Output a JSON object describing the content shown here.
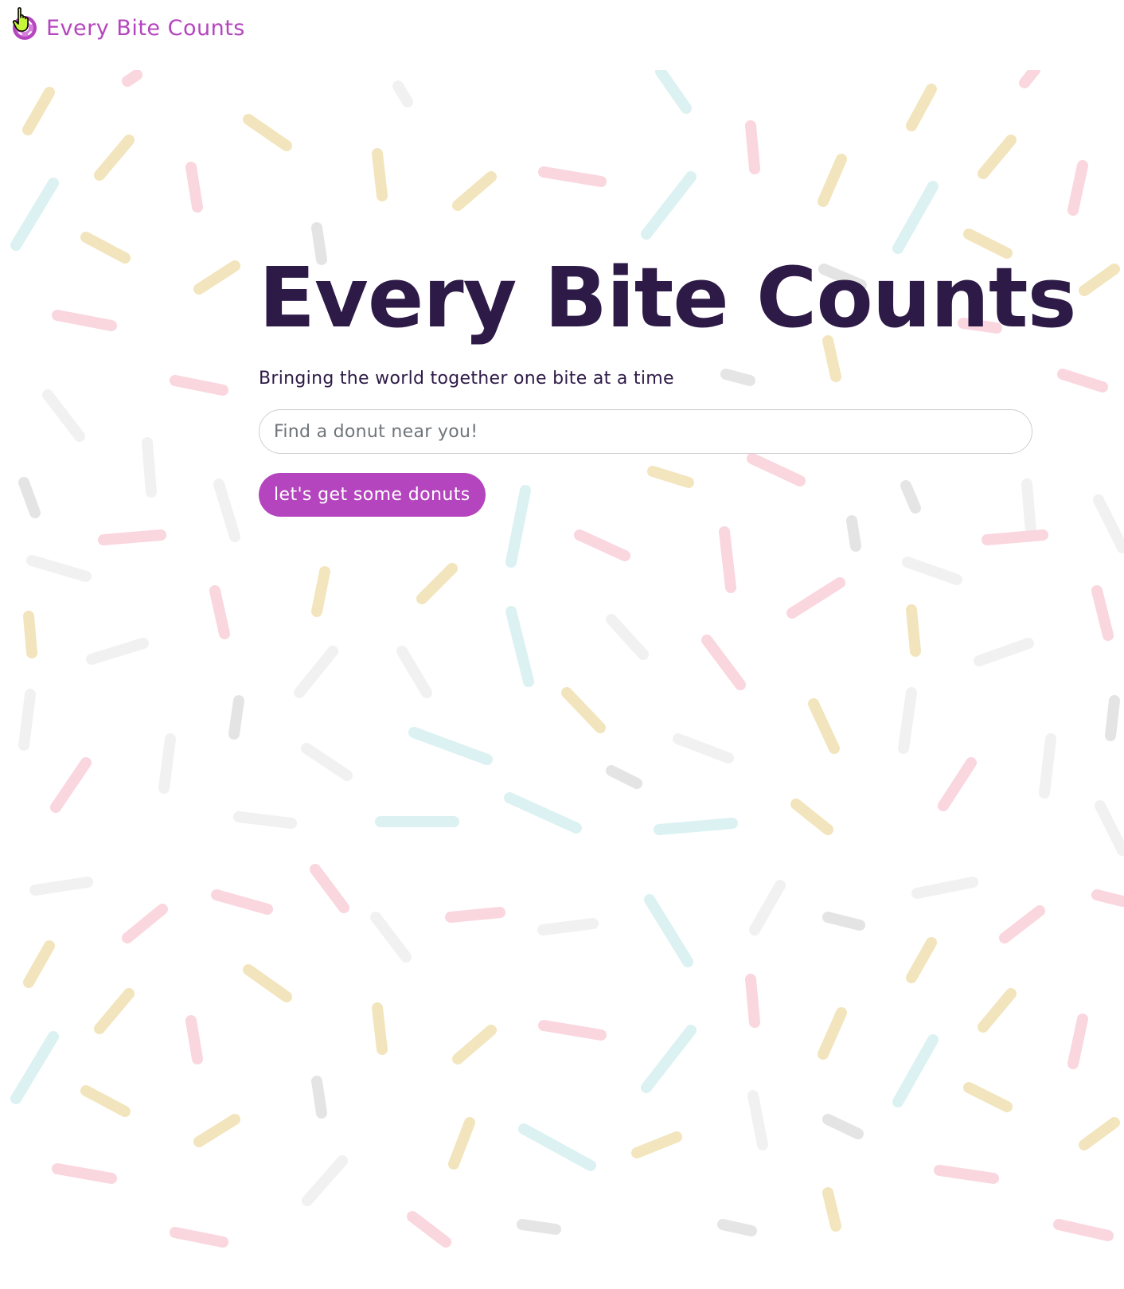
{
  "nav": {
    "brand_name": "Every Bite Counts",
    "logo_icon": "donut-logo-icon"
  },
  "hero": {
    "title": "Every Bite Counts",
    "subtitle": "Bringing the world together one bite at a time"
  },
  "search": {
    "placeholder": "Find a donut near you!",
    "value": ""
  },
  "cta": {
    "label": "let's get some donuts"
  },
  "colors": {
    "accent": "#b545be",
    "heading": "#2e1a47",
    "sprinkle_yellow": "#e9d08a",
    "sprinkle_pink": "#f6b5c4",
    "sprinkle_teal": "#bfe6e8",
    "sprinkle_gray": "#cfcfcf"
  }
}
